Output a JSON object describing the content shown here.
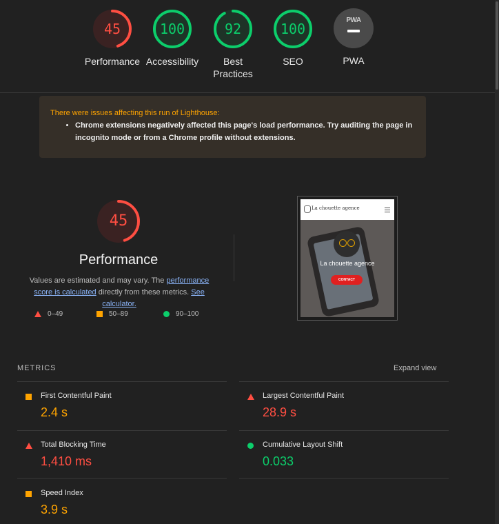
{
  "top_gauges": [
    {
      "score": "45",
      "label": "Performance",
      "status": "fail",
      "value": 45,
      "color": "#ff4e42"
    },
    {
      "score": "100",
      "label": "Accessibility",
      "status": "pass",
      "value": 100,
      "color": "#0cce6b"
    },
    {
      "score": "92",
      "label": "Best Practices",
      "status": "pass",
      "value": 92,
      "color": "#0cce6b"
    },
    {
      "score": "100",
      "label": "SEO",
      "status": "pass",
      "value": 100,
      "color": "#0cce6b"
    },
    {
      "label": "PWA",
      "badge_text": "PWA",
      "icon": "pwa-icon"
    }
  ],
  "warning": {
    "title": "There were issues affecting this run of Lighthouse:",
    "items": [
      "Chrome extensions negatively affected this page's load performance. Try auditing the page in incognito mode or from a Chrome profile without extensions."
    ]
  },
  "performance": {
    "score": "45",
    "value": 45,
    "title": "Performance",
    "desc_prefix": "Values are estimated and may vary. The ",
    "link1": "performance score is calculated",
    "desc_middle": " directly from these metrics. ",
    "link2": "See calculator.",
    "legend": [
      {
        "range": "0–49",
        "icon": "triangle-fail-icon"
      },
      {
        "range": "50–89",
        "icon": "square-average-icon"
      },
      {
        "range": "90–100",
        "icon": "circle-pass-icon"
      }
    ]
  },
  "screenshot": {
    "brand": "La chouette agence",
    "hero_title": "La chouette agence",
    "cta": "CONTACT"
  },
  "metrics": {
    "header": "METRICS",
    "expand": "Expand view",
    "items": [
      {
        "name": "First Contentful Paint",
        "value": "2.4 s",
        "status": "avg"
      },
      {
        "name": "Largest Contentful Paint",
        "value": "28.9 s",
        "status": "fail"
      },
      {
        "name": "Total Blocking Time",
        "value": "1,410 ms",
        "status": "fail"
      },
      {
        "name": "Cumulative Layout Shift",
        "value": "0.033",
        "status": "pass"
      },
      {
        "name": "Speed Index",
        "value": "3.9 s",
        "status": "avg"
      }
    ]
  },
  "colors": {
    "fail": "#ff4e42",
    "average": "#ffa400",
    "pass": "#0cce6b",
    "background": "#212121"
  }
}
